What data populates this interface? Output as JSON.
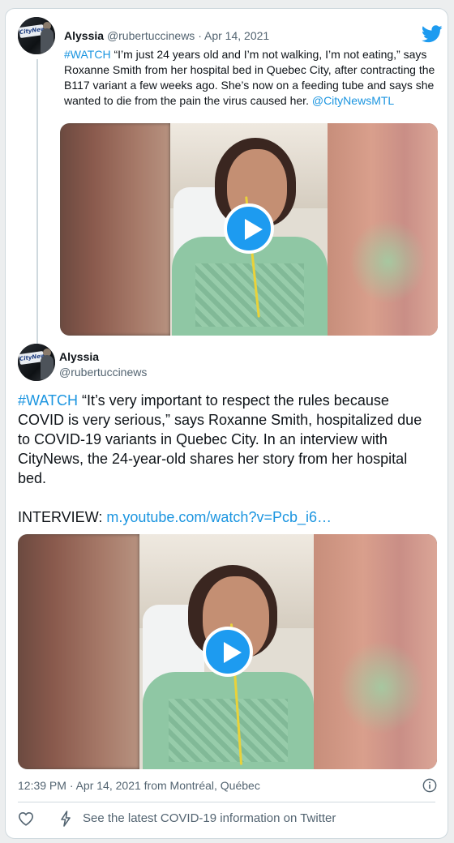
{
  "quoted_tweet": {
    "name": "Alyssia",
    "handle": "@rubertuccinews",
    "date": "Apr 14, 2021",
    "hashtag": "#WATCH",
    "text": " “I’m just 24 years old and I’m not walking, I’m not eating,” says Roxanne Smith from her hospital bed in Quebec City, after contracting the B117 variant a few weeks ago. She’s now on a feeding tube and says she wanted to die from the pain the virus caused her. ",
    "mention": "@CityNewsMTL",
    "avatar_text": "CityNews"
  },
  "main_tweet": {
    "name": "Alyssia",
    "handle": "@rubertuccinews",
    "hashtag": "#WATCH",
    "text": " “It’s very important to respect the rules because COVID is very serious,” says Roxanne Smith, hospitalized due to COVID-19 variants in Quebec City. In an interview with CityNews, the 24-year-old shares her story from her hospital bed.",
    "interview_label": "INTERVIEW: ",
    "link": "m.youtube.com/watch?v=Pcb_i6…",
    "timestamp": "12:39 PM · Apr 14, 2021 from Montréal, Québec",
    "avatar_text": "CityNews"
  },
  "footer": {
    "covid_link": "See the latest COVID-19 information on Twitter"
  },
  "colors": {
    "link": "#1b95e0",
    "play_button": "#1d9bf0",
    "twitter_blue": "#1d9bf0",
    "muted_text": "#536471"
  },
  "icons": [
    "twitter-logo-icon",
    "play-icon",
    "info-icon",
    "heart-icon",
    "lightning-bolt-icon"
  ]
}
